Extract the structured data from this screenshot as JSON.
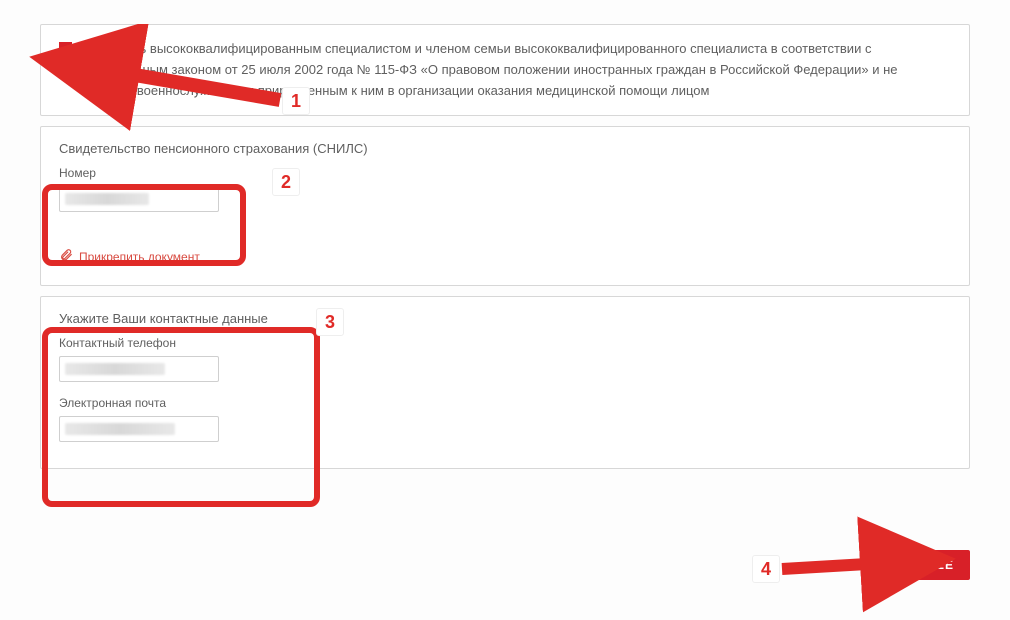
{
  "declaration": {
    "checkbox_checked": true,
    "text": "Я являюсь высококвалифицированным специалистом и членом семьи высококвалифицированного специалиста в соответствии с Федеральным законом от 25 июля 2002 года № 115-ФЗ «О правовом положении иностранных граждан в Российской Федерации» и не являюсь военнослужащим и приравненным к ним в организации оказания медицинской помощи лицом"
  },
  "snils": {
    "section_title": "Свидетельство пенсионного страхования (СНИЛС)",
    "number_label": "Номер",
    "number_value": "",
    "attach_label": "Прикрепить документ"
  },
  "contacts": {
    "section_title": "Укажите Ваши контактные данные",
    "phone_label": "Контактный телефон",
    "phone_value": "",
    "email_label": "Электронная почта",
    "email_value": ""
  },
  "buttons": {
    "next": "ДАЛЕЕ"
  },
  "callouts": {
    "c1": "1",
    "c2": "2",
    "c3": "3",
    "c4": "4"
  }
}
